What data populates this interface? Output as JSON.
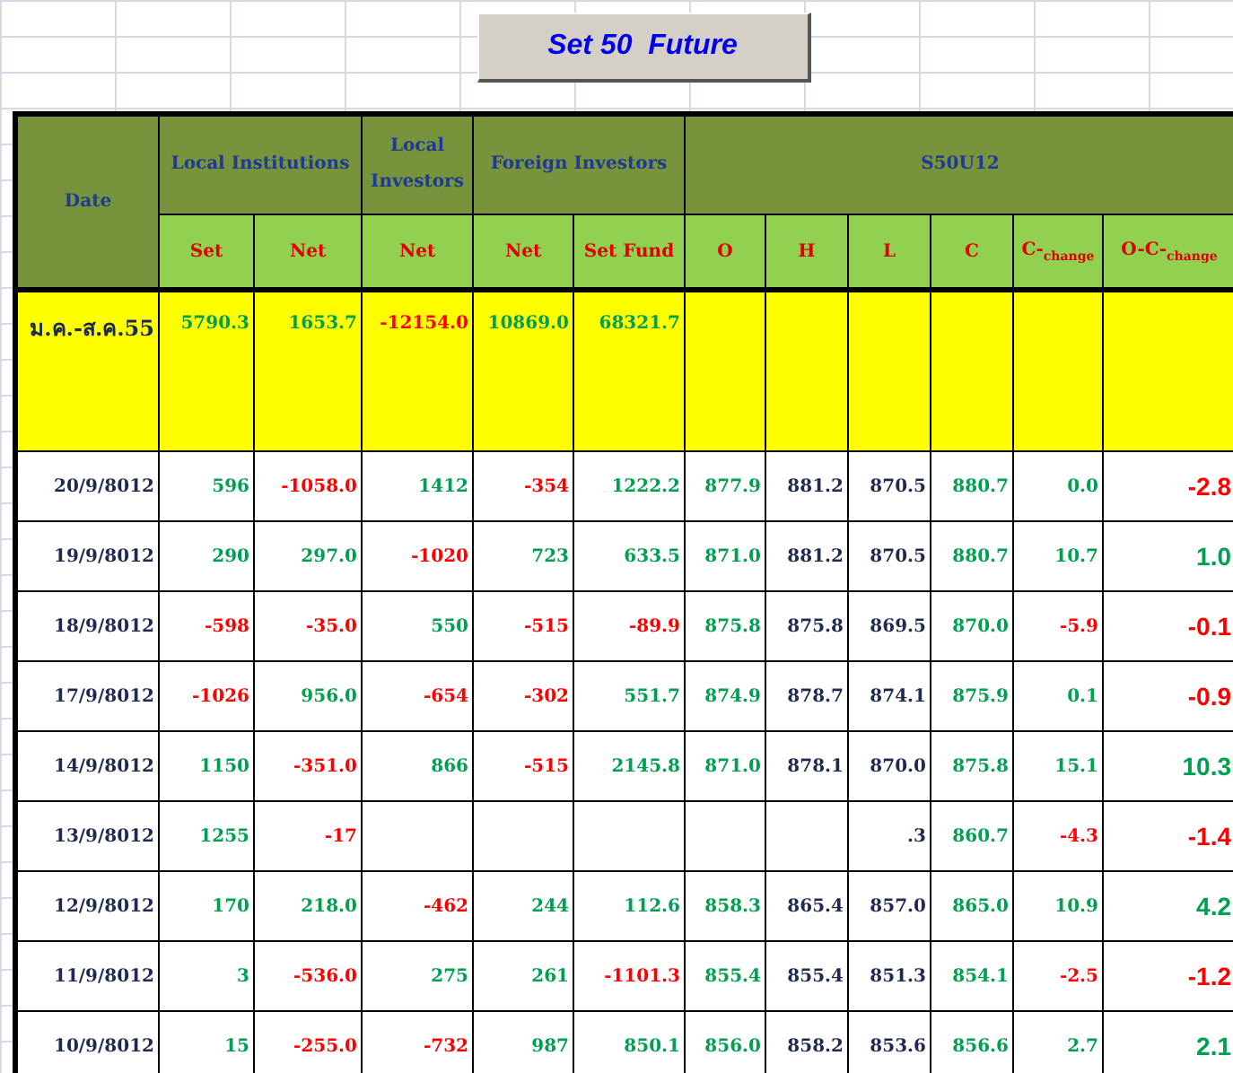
{
  "title": "Set 50  Future",
  "header": {
    "date_label": "Date",
    "groups": [
      {
        "label": "Local Institutions"
      },
      {
        "label": "Local Investors"
      },
      {
        "label": "Foreign Investors"
      },
      {
        "label": "S50U12"
      }
    ],
    "columns": [
      "Set",
      "Net",
      "Net",
      "Net",
      "Set Fund",
      "O",
      "H",
      "L",
      "C",
      "C-$_{change}$",
      "O-C-$_{change}$"
    ]
  },
  "summary": {
    "date": "ม.ค.-ส.ค.55",
    "cells": [
      {
        "v": "5790.3",
        "color": "#00a050"
      },
      {
        "v": "1653.7",
        "color": "#00a050"
      },
      {
        "v": "-12154.0",
        "color": "#ff0000"
      },
      {
        "v": "10869.0",
        "color": "#00a050"
      },
      {
        "v": "68321.7",
        "color": "#00a050"
      }
    ]
  },
  "rows": [
    {
      "date": "20/9/8012",
      "cells": [
        {
          "v": "596",
          "color": "#00a050"
        },
        {
          "v": "-1058.0",
          "color": "#ff0000"
        },
        {
          "v": "1412",
          "color": "#00a050"
        },
        {
          "v": "-354",
          "color": "#ff0000"
        },
        {
          "v": "1222.2",
          "color": "#00a050"
        },
        {
          "v": "877.9",
          "color": "#00a050"
        },
        {
          "v": "881.2",
          "color": "#1f2a50"
        },
        {
          "v": "870.5",
          "color": "#1f2a50"
        },
        {
          "v": "880.7",
          "color": "#00a050"
        },
        {
          "v": "0.0",
          "color": "#00a050"
        },
        {
          "v": "-2.8",
          "color": "#ff0000"
        }
      ]
    },
    {
      "date": "19/9/8012",
      "cells": [
        {
          "v": "290",
          "color": "#00a050"
        },
        {
          "v": "297.0",
          "color": "#00a050"
        },
        {
          "v": "-1020",
          "color": "#ff0000"
        },
        {
          "v": "723",
          "color": "#00a050"
        },
        {
          "v": "633.5",
          "color": "#00a050"
        },
        {
          "v": "871.0",
          "color": "#00a050"
        },
        {
          "v": "881.2",
          "color": "#1f2a50"
        },
        {
          "v": "870.5",
          "color": "#1f2a50"
        },
        {
          "v": "880.7",
          "color": "#00a050"
        },
        {
          "v": "10.7",
          "color": "#00a050"
        },
        {
          "v": "1.0",
          "color": "#00a050"
        }
      ]
    },
    {
      "date": "18/9/8012",
      "cells": [
        {
          "v": "-598",
          "color": "#ff0000"
        },
        {
          "v": "-35.0",
          "color": "#ff0000"
        },
        {
          "v": "550",
          "color": "#00a050"
        },
        {
          "v": "-515",
          "color": "#ff0000"
        },
        {
          "v": "-89.9",
          "color": "#ff0000"
        },
        {
          "v": "875.8",
          "color": "#00a050"
        },
        {
          "v": "875.8",
          "color": "#1f2a50"
        },
        {
          "v": "869.5",
          "color": "#1f2a50"
        },
        {
          "v": "870.0",
          "color": "#00a050"
        },
        {
          "v": "-5.9",
          "color": "#ff0000"
        },
        {
          "v": "-0.1",
          "color": "#ff0000"
        }
      ]
    },
    {
      "date": "17/9/8012",
      "cells": [
        {
          "v": "-1026",
          "color": "#ff0000"
        },
        {
          "v": "956.0",
          "color": "#00a050"
        },
        {
          "v": "-654",
          "color": "#ff0000"
        },
        {
          "v": "-302",
          "color": "#ff0000"
        },
        {
          "v": "551.7",
          "color": "#00a050"
        },
        {
          "v": "874.9",
          "color": "#00a050"
        },
        {
          "v": "878.7",
          "color": "#1f2a50"
        },
        {
          "v": "874.1",
          "color": "#1f2a50"
        },
        {
          "v": "875.9",
          "color": "#00a050"
        },
        {
          "v": "0.1",
          "color": "#00a050"
        },
        {
          "v": "-0.9",
          "color": "#ff0000"
        }
      ]
    },
    {
      "date": "14/9/8012",
      "cells": [
        {
          "v": "1150",
          "color": "#00a050"
        },
        {
          "v": "-351.0",
          "color": "#ff0000"
        },
        {
          "v": "866",
          "color": "#00a050"
        },
        {
          "v": "-515",
          "color": "#ff0000"
        },
        {
          "v": "2145.8",
          "color": "#00a050"
        },
        {
          "v": "871.0",
          "color": "#00a050"
        },
        {
          "v": "878.1",
          "color": "#1f2a50"
        },
        {
          "v": "870.0",
          "color": "#1f2a50"
        },
        {
          "v": "875.8",
          "color": "#00a050"
        },
        {
          "v": "15.1",
          "color": "#00a050"
        },
        {
          "v": "10.3",
          "color": "#00a050"
        }
      ]
    },
    {
      "date": "13/9/8012",
      "cells": [
        {
          "v": "1255",
          "color": "#00a050"
        },
        {
          "v": "-17",
          "color": "#ff0000"
        },
        null,
        null,
        null,
        null,
        null,
        {
          "v": ".3",
          "color": "#1f2a50"
        },
        {
          "v": "860.7",
          "color": "#00a050"
        },
        {
          "v": "-4.3",
          "color": "#ff0000"
        },
        {
          "v": "-1.4",
          "color": "#ff0000"
        }
      ]
    },
    {
      "date": "12/9/8012",
      "cells": [
        {
          "v": "170",
          "color": "#00a050"
        },
        {
          "v": "218.0",
          "color": "#00a050"
        },
        {
          "v": "-462",
          "color": "#ff0000"
        },
        {
          "v": "244",
          "color": "#00a050"
        },
        {
          "v": "112.6",
          "color": "#00a050"
        },
        {
          "v": "858.3",
          "color": "#00a050"
        },
        {
          "v": "865.4",
          "color": "#1f2a50"
        },
        {
          "v": "857.0",
          "color": "#1f2a50"
        },
        {
          "v": "865.0",
          "color": "#00a050"
        },
        {
          "v": "10.9",
          "color": "#00a050"
        },
        {
          "v": "4.2",
          "color": "#00a050"
        }
      ]
    },
    {
      "date": "11/9/8012",
      "cells": [
        {
          "v": "3",
          "color": "#00a050"
        },
        {
          "v": "-536.0",
          "color": "#ff0000"
        },
        {
          "v": "275",
          "color": "#00a050"
        },
        {
          "v": "261",
          "color": "#00a050"
        },
        {
          "v": "-1101.3",
          "color": "#ff0000"
        },
        {
          "v": "855.4",
          "color": "#00a050"
        },
        {
          "v": "855.4",
          "color": "#1f2a50"
        },
        {
          "v": "851.3",
          "color": "#1f2a50"
        },
        {
          "v": "854.1",
          "color": "#00a050"
        },
        {
          "v": "-2.5",
          "color": "#ff0000"
        },
        {
          "v": "-1.2",
          "color": "#ff0000"
        }
      ]
    },
    {
      "date": "10/9/8012",
      "cells": [
        {
          "v": "15",
          "color": "#00a050"
        },
        {
          "v": "-255.0",
          "color": "#ff0000"
        },
        {
          "v": "-732",
          "color": "#ff0000"
        },
        {
          "v": "987",
          "color": "#00a050"
        },
        {
          "v": "850.1",
          "color": "#00a050"
        },
        {
          "v": "856.0",
          "color": "#00a050"
        },
        {
          "v": "858.2",
          "color": "#1f2a50"
        },
        {
          "v": "853.6",
          "color": "#1f2a50"
        },
        {
          "v": "856.6",
          "color": "#00a050"
        },
        {
          "v": "2.7",
          "color": "#00a050"
        },
        {
          "v": "2.1",
          "color": "#00a050"
        }
      ]
    }
  ]
}
